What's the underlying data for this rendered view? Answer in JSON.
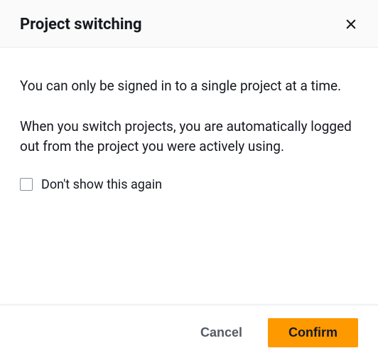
{
  "header": {
    "title": "Project switching"
  },
  "body": {
    "paragraph1": "You can only be signed in to a single project at a time.",
    "paragraph2": "When you switch projects, you are automatically logged out from the project you were actively using.",
    "checkbox_label": "Don't show this again"
  },
  "footer": {
    "cancel_label": "Cancel",
    "confirm_label": "Confirm"
  }
}
